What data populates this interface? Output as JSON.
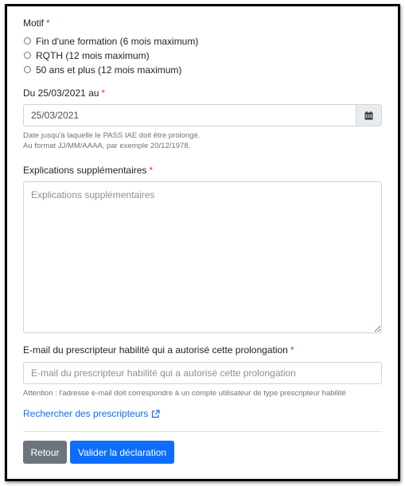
{
  "form": {
    "motif": {
      "label": "Motif",
      "required": "*",
      "options": [
        "Fin d'une formation (6 mois maximum)",
        "RQTH (12 mois maximum)",
        "50 ans et plus (12 mois maximum)"
      ]
    },
    "date": {
      "label": "Du 25/03/2021 au",
      "required": "*",
      "value": "25/03/2021",
      "help_line1": "Date jusqu'à laquelle le PASS IAE doit être prolongé.",
      "help_line2": "Au format JJ/MM/AAAA, par exemple 20/12/1978.",
      "calendar_icon": "calendar-icon"
    },
    "explications": {
      "label": "Explications supplémentaires",
      "required": "*",
      "placeholder": "Explications supplémentaires"
    },
    "email": {
      "label": "E-mail du prescripteur habilité qui a autorisé cette prolongation",
      "required": "*",
      "placeholder": "E-mail du prescripteur habilité qui a autorisé cette prolongation",
      "help": "Attention : l'adresse e-mail doit correspondre à un compte utilisateur de type prescripteur habilité"
    },
    "link": {
      "label": "Rechercher des prescripteurs",
      "icon": "external-link-icon"
    },
    "buttons": {
      "back": "Retour",
      "submit": "Valider la déclaration"
    }
  },
  "colors": {
    "required": "#dc3545",
    "link": "#0d6efd",
    "primary": "#0d6efd",
    "secondary": "#6c757d"
  }
}
